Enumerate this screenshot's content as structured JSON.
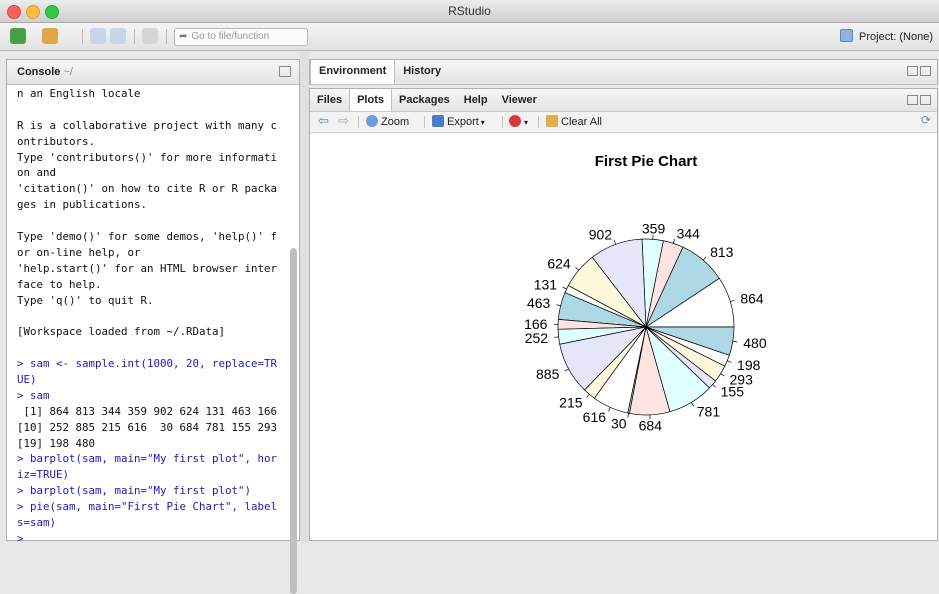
{
  "window": {
    "title": "RStudio"
  },
  "toolbar": {
    "goto_placeholder": "Go to file/function",
    "project_label": "Project: (None)"
  },
  "console": {
    "title": "Console",
    "path": "~/",
    "lines": [
      {
        "t": "n an English locale",
        "k": "out"
      },
      {
        "t": "",
        "k": "out"
      },
      {
        "t": "R is a collaborative project with many c",
        "k": "out"
      },
      {
        "t": "ontributors.",
        "k": "out"
      },
      {
        "t": "Type 'contributors()' for more informati",
        "k": "out"
      },
      {
        "t": "on and",
        "k": "out"
      },
      {
        "t": "'citation()' on how to cite R or R packa",
        "k": "out"
      },
      {
        "t": "ges in publications.",
        "k": "out"
      },
      {
        "t": "",
        "k": "out"
      },
      {
        "t": "Type 'demo()' for some demos, 'help()' f",
        "k": "out"
      },
      {
        "t": "or on-line help, or",
        "k": "out"
      },
      {
        "t": "'help.start()' for an HTML browser inter",
        "k": "out"
      },
      {
        "t": "face to help.",
        "k": "out"
      },
      {
        "t": "Type 'q()' to quit R.",
        "k": "out"
      },
      {
        "t": "",
        "k": "out"
      },
      {
        "t": "[Workspace loaded from ~/.RData]",
        "k": "out"
      },
      {
        "t": "",
        "k": "out"
      },
      {
        "t": "> sam <- sample.int(1000, 20, replace=TR",
        "k": "in"
      },
      {
        "t": "UE)",
        "k": "in"
      },
      {
        "t": "> sam",
        "k": "in"
      },
      {
        "t": " [1] 864 813 344 359 902 624 131 463 166",
        "k": "out"
      },
      {
        "t": "[10] 252 885 215 616  30 684 781 155 293",
        "k": "out"
      },
      {
        "t": "[19] 198 480",
        "k": "out"
      },
      {
        "t": "> barplot(sam, main=\"My first plot\", hor",
        "k": "in"
      },
      {
        "t": "iz=TRUE)",
        "k": "in"
      },
      {
        "t": "> barplot(sam, main=\"My first plot\")",
        "k": "in"
      },
      {
        "t": "> pie(sam, main=\"First Pie Chart\", label",
        "k": "in"
      },
      {
        "t": "s=sam)",
        "k": "in"
      },
      {
        "t": ">",
        "k": "in"
      }
    ]
  },
  "env_tabs": [
    "Environment",
    "History"
  ],
  "plot_tabs": [
    "Files",
    "Plots",
    "Packages",
    "Help",
    "Viewer"
  ],
  "plot_toolbar": {
    "zoom": "Zoom",
    "export": "Export",
    "clear": "Clear All"
  },
  "chart_data": {
    "type": "pie",
    "title": "First Pie Chart",
    "labels": [
      "864",
      "813",
      "344",
      "359",
      "902",
      "624",
      "131",
      "463",
      "166",
      "252",
      "885",
      "215",
      "616",
      "30",
      "684",
      "781",
      "155",
      "293",
      "198",
      "480"
    ],
    "values": [
      864,
      813,
      344,
      359,
      902,
      624,
      131,
      463,
      166,
      252,
      885,
      215,
      616,
      30,
      684,
      781,
      155,
      293,
      198,
      480
    ],
    "colors": [
      "#ffffff",
      "#add8e6",
      "#ffe4e1",
      "#e0ffff",
      "#e6e6fa",
      "#fff8dc",
      "#ffffff",
      "#add8e6",
      "#ffe4e1",
      "#e0ffff",
      "#e6e6fa",
      "#fff8dc",
      "#ffffff",
      "#add8e6",
      "#ffe4e1",
      "#e0ffff",
      "#e6e6fa",
      "#fff8dc",
      "#ffffff",
      "#add8e6"
    ],
    "start_angle_deg": 0,
    "direction": "counterclockwise"
  }
}
